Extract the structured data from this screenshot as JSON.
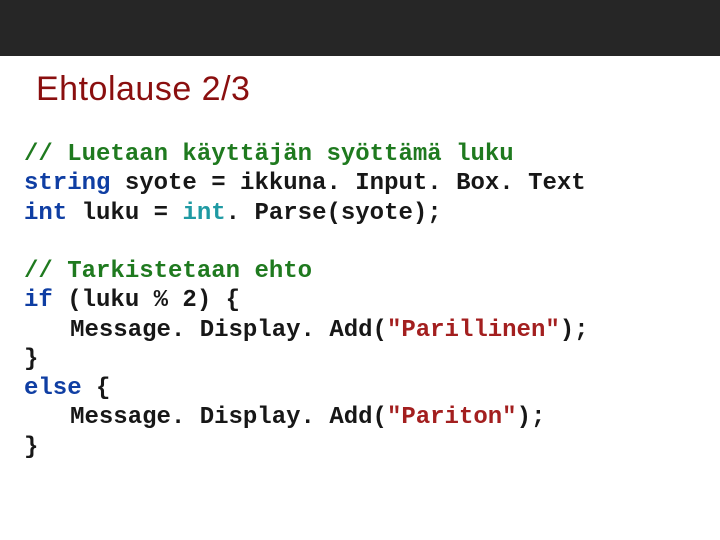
{
  "title": "Ehtolause 2/3",
  "code": {
    "c1": "// Luetaan käyttäjän syöttämä luku",
    "l1_kw": "string",
    "l1_rest": " syote = ikkuna. Input. Box. Text",
    "l2_kw": "int",
    "l2_mid": " luku = ",
    "l2_type": "int",
    "l2_rest": ". Parse(syote);",
    "c2": "// Tarkistetaan ehto",
    "l3_kw": "if",
    "l3_rest": " (luku % 2) {",
    "l4_call": "Message. Display. Add(",
    "l4_str": "\"Parillinen\"",
    "l4_end": ");",
    "l5": "}",
    "l6_kw": "else",
    "l6_rest": " {",
    "l7_call": "Message. Display. Add(",
    "l7_str": "\"Pariton\"",
    "l7_end": ");",
    "l8": "}"
  }
}
